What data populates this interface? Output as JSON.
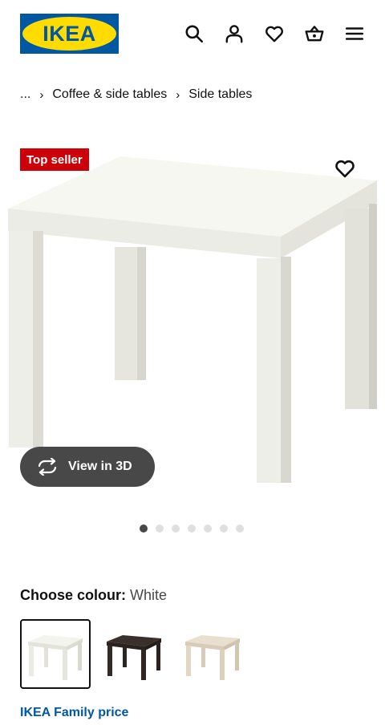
{
  "header": {
    "logo_text": "IKEA",
    "icons": [
      "search-icon",
      "account-icon",
      "heart-icon",
      "basket-icon",
      "menu-icon"
    ],
    "brand_blue": "#0058a3",
    "brand_yellow": "#ffdb00"
  },
  "breadcrumb": {
    "items": [
      "...",
      "Coffee & side tables",
      "Side tables"
    ],
    "separator": "›"
  },
  "gallery": {
    "badge": "Top seller",
    "badge_color": "#cc0008",
    "view3d_label": "View in 3D",
    "dots_total": 7,
    "active_dot": 1
  },
  "colour": {
    "label": "Choose colour:",
    "selected": "White",
    "options": [
      "White",
      "Black-brown",
      "White stained oak effect"
    ]
  },
  "price": {
    "family_label": "IKEA Family price",
    "family_color": "#0058a3"
  }
}
